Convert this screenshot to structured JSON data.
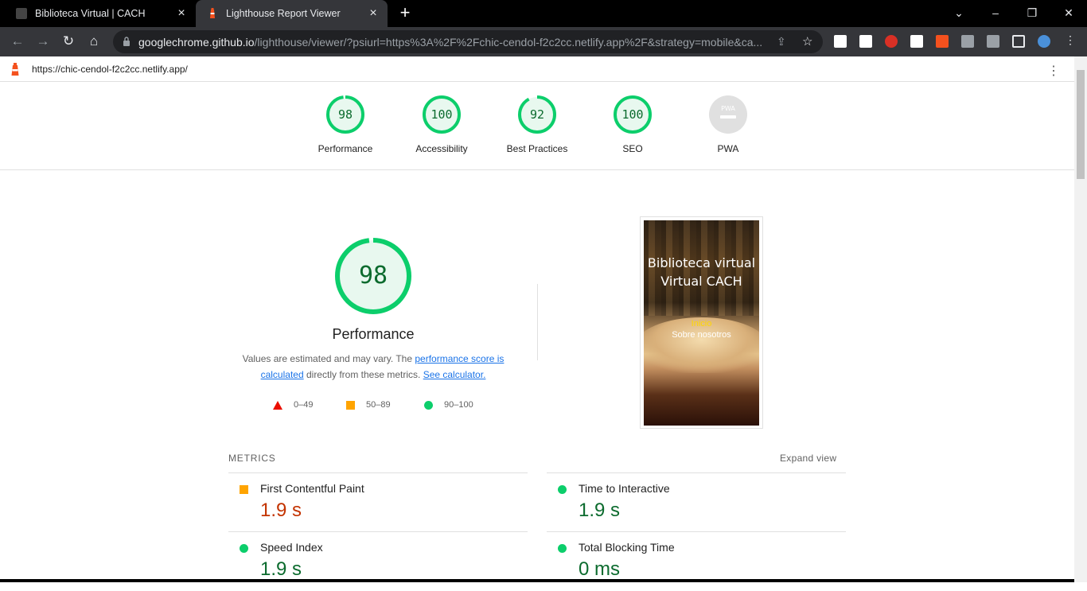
{
  "browser": {
    "tabs": [
      {
        "title": "Biblioteca Virtual | CACH",
        "active": false
      },
      {
        "title": "Lighthouse Report Viewer",
        "active": true
      }
    ],
    "url_domain": "googlechrome.github.io",
    "url_rest": "/lighthouse/viewer/?psiurl=https%3A%2F%2Fchic-cendol-f2c2cc.netlify.app%2F&strategy=mobile&ca..."
  },
  "report": {
    "page_url": "https://chic-cendol-f2c2cc.netlify.app/"
  },
  "gauges": [
    {
      "score": "98",
      "label": "Performance"
    },
    {
      "score": "100",
      "label": "Accessibility"
    },
    {
      "score": "92",
      "label": "Best Practices"
    },
    {
      "score": "100",
      "label": "SEO"
    },
    {
      "score": "",
      "label": "PWA"
    }
  ],
  "performance": {
    "score": "98",
    "title": "Performance",
    "desc_prefix": "Values are estimated and may vary. The ",
    "desc_link1": "performance score is calculated",
    "desc_mid": " directly from these metrics. ",
    "desc_link2": "See calculator.",
    "legend": {
      "fail": "0–49",
      "average": "50–89",
      "pass": "90–100"
    }
  },
  "screenshot": {
    "title": "Biblioteca virtual Virtual CACH",
    "link1": "Inicio",
    "link2": "Sobre nosotros"
  },
  "metrics": {
    "heading": "METRICS",
    "expand_label": "Expand view",
    "items": [
      {
        "name": "First Contentful Paint",
        "value": "1.9 s",
        "rating": "average"
      },
      {
        "name": "Time to Interactive",
        "value": "1.9 s",
        "rating": "pass"
      },
      {
        "name": "Speed Index",
        "value": "1.9 s",
        "rating": "pass"
      },
      {
        "name": "Total Blocking Time",
        "value": "0 ms",
        "rating": "pass"
      }
    ]
  },
  "colors": {
    "pass": "#0cce6b",
    "pass_text": "#0c6b2e",
    "average": "#ffa400",
    "average_text": "#c33300",
    "fail": "#eb0f00",
    "link": "#1a73e8"
  }
}
